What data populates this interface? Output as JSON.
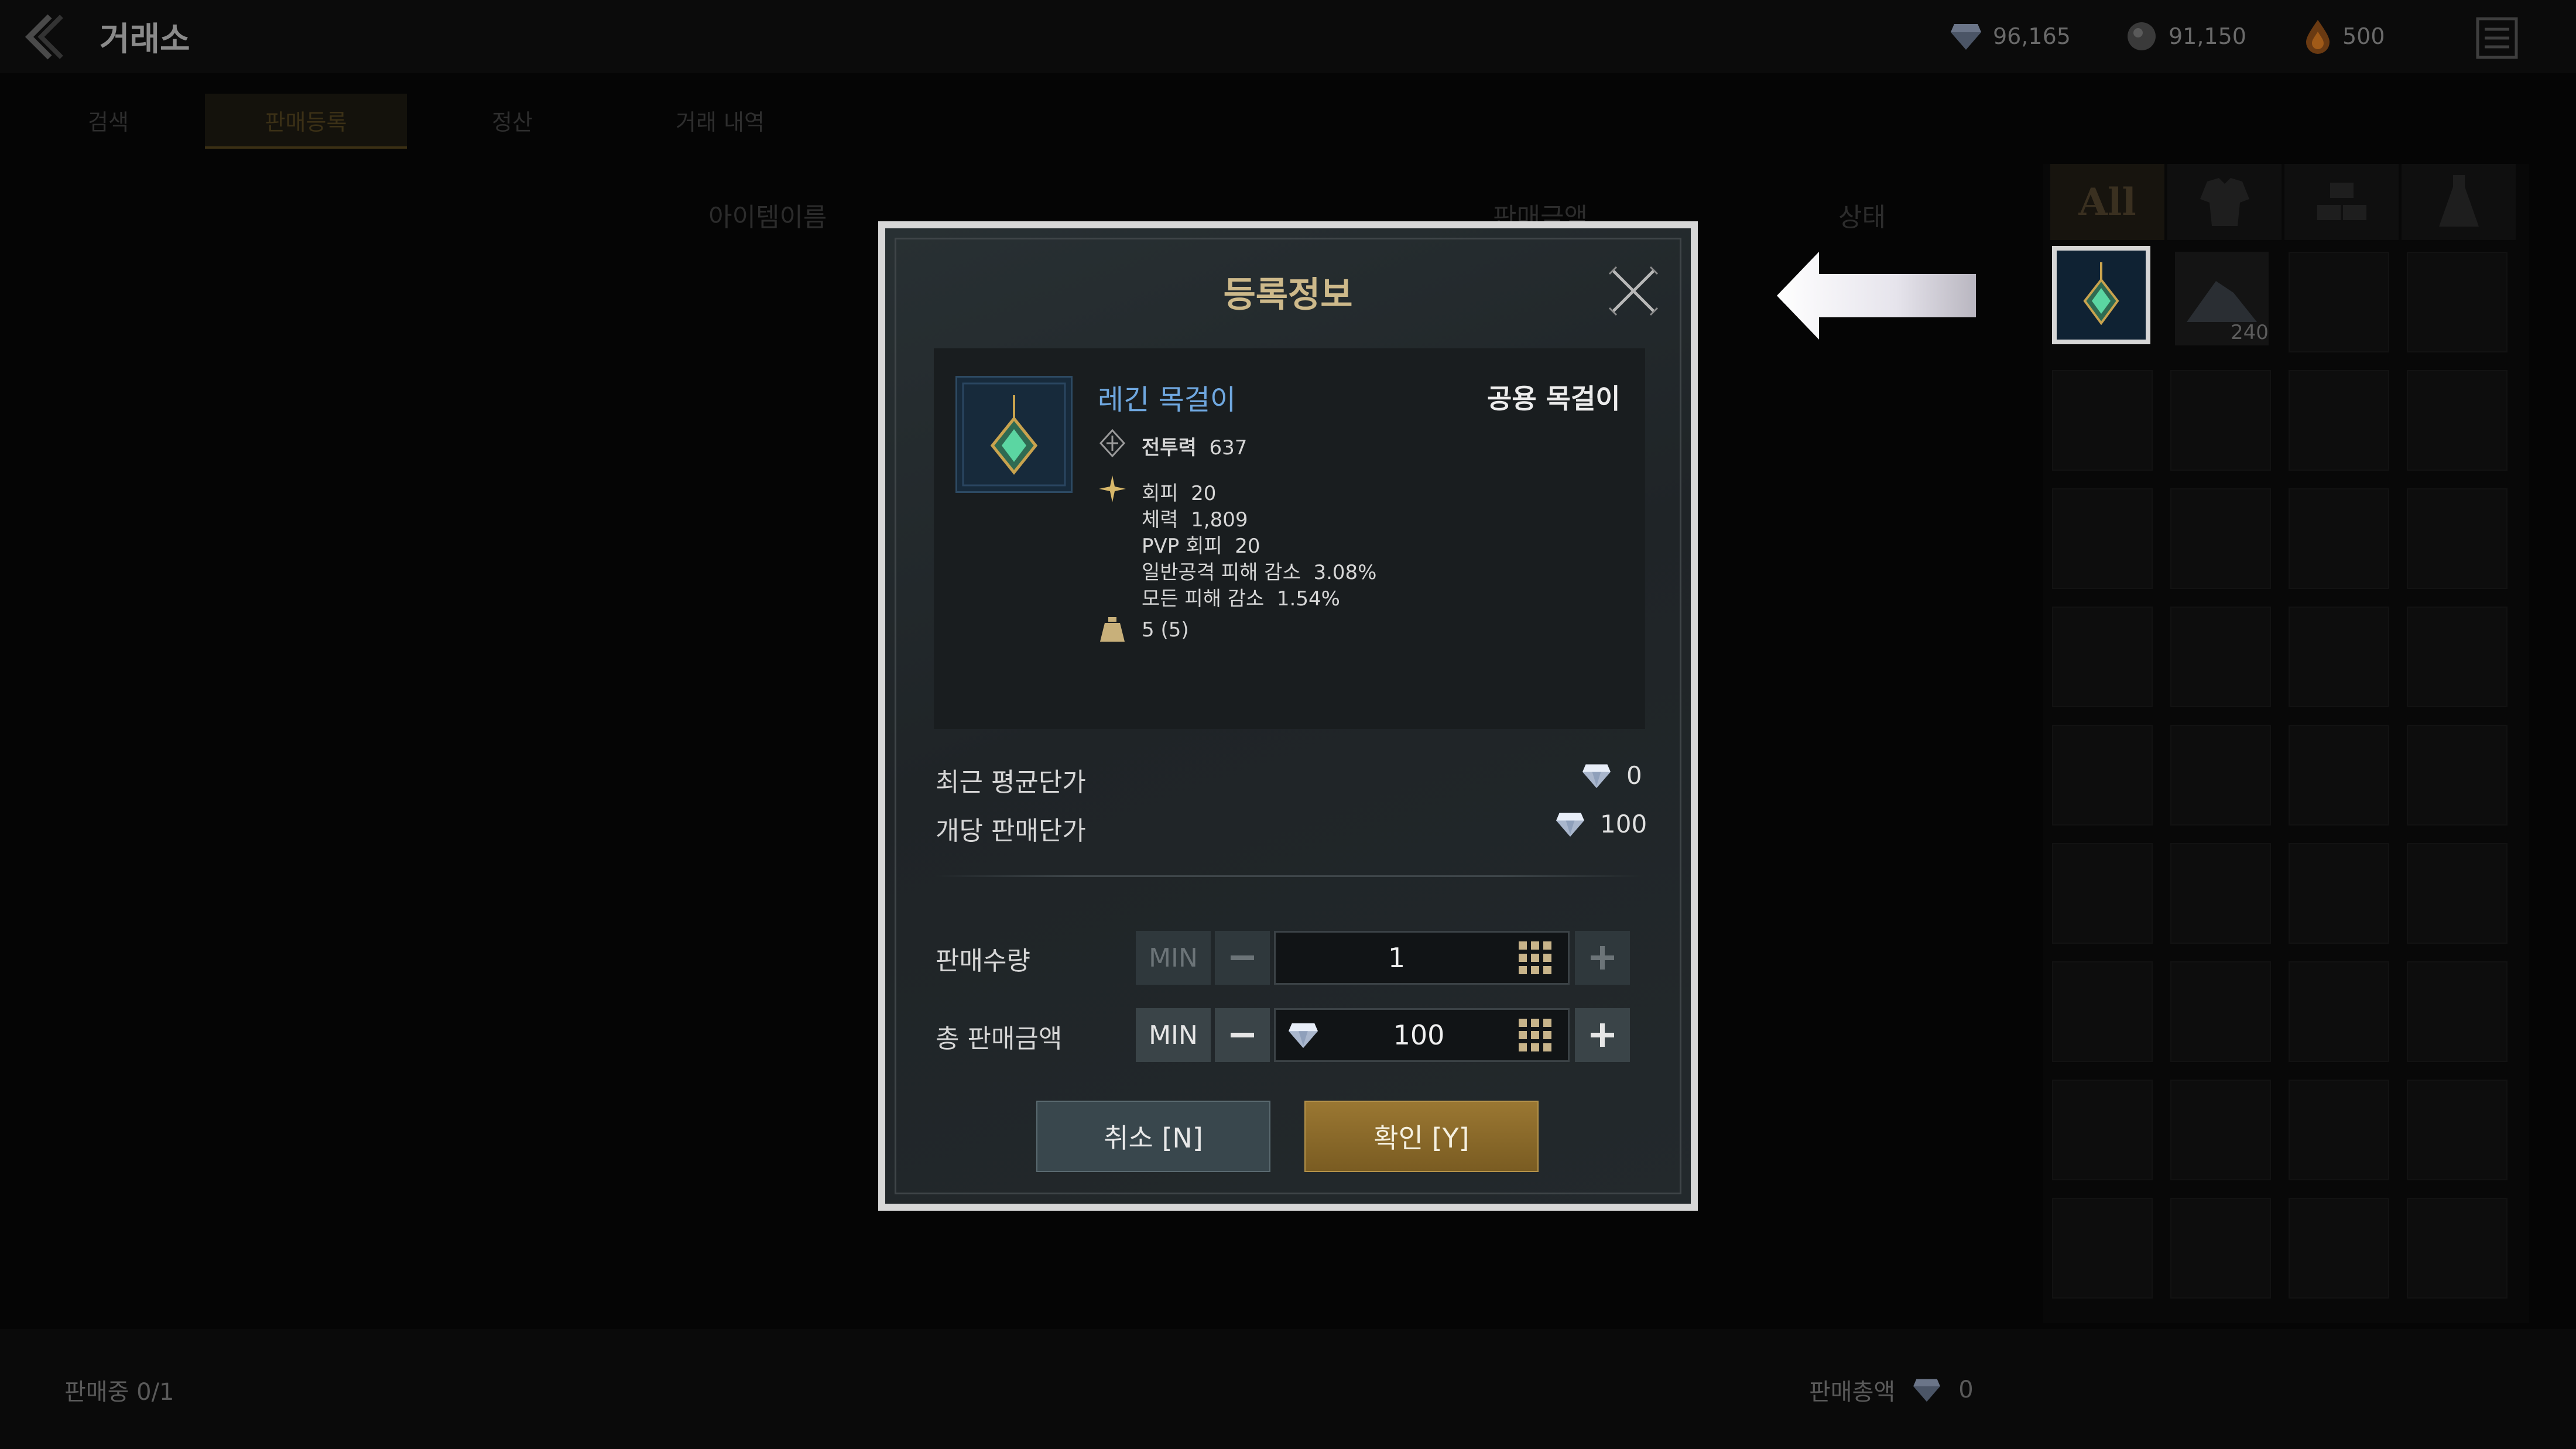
{
  "header": {
    "title": "거래소",
    "currencies": [
      {
        "icon": "diamond-icon",
        "value": "96,165"
      },
      {
        "icon": "dark-orb-icon",
        "value": "91,150"
      },
      {
        "icon": "flame-drop-icon",
        "value": "500"
      }
    ]
  },
  "tabs": [
    {
      "label": "검색"
    },
    {
      "label": "판매등록",
      "active": true
    },
    {
      "label": "정산"
    },
    {
      "label": "거래 내역"
    }
  ],
  "list_headers": {
    "item_name": "아이템이름",
    "price": "판매금액",
    "status": "상태"
  },
  "inventory": {
    "filters": [
      {
        "label": "All",
        "active": true
      },
      {
        "label": "",
        "icon": "armor-icon"
      },
      {
        "label": "",
        "icon": "ingots-icon"
      },
      {
        "label": "",
        "icon": "potion-icon"
      }
    ],
    "slot2_count": "240"
  },
  "footer": {
    "selling_label": "판매중 0/1",
    "total_label": "판매총액",
    "total_value": "0"
  },
  "modal": {
    "title": "등록정보",
    "item": {
      "name": "레긴 목걸이",
      "type": "공용 목걸이",
      "power_label": "전투력",
      "power_value": "637",
      "stats": [
        "회피  20",
        "체력  1,809",
        "PVP 회피  20",
        "일반공격 피해 감소  3.08%",
        "모든 피해 감소  1.54%"
      ],
      "weight": "5 (5)"
    },
    "recent_avg_label": "최근 평균단가",
    "recent_avg_value": "0",
    "unit_price_label": "개당 판매단가",
    "unit_price_value": "100",
    "quantity_label": "판매수량",
    "quantity_value": "1",
    "total_label": "총 판매금액",
    "total_value": "100",
    "min_label": "MIN",
    "cancel_label": "취소 [N]",
    "confirm_label": "확인 [Y]"
  },
  "colors": {
    "accent_gold": "#cdb98a",
    "item_name_blue": "#6fa7df",
    "confirm_button": "#8a6a2a"
  }
}
